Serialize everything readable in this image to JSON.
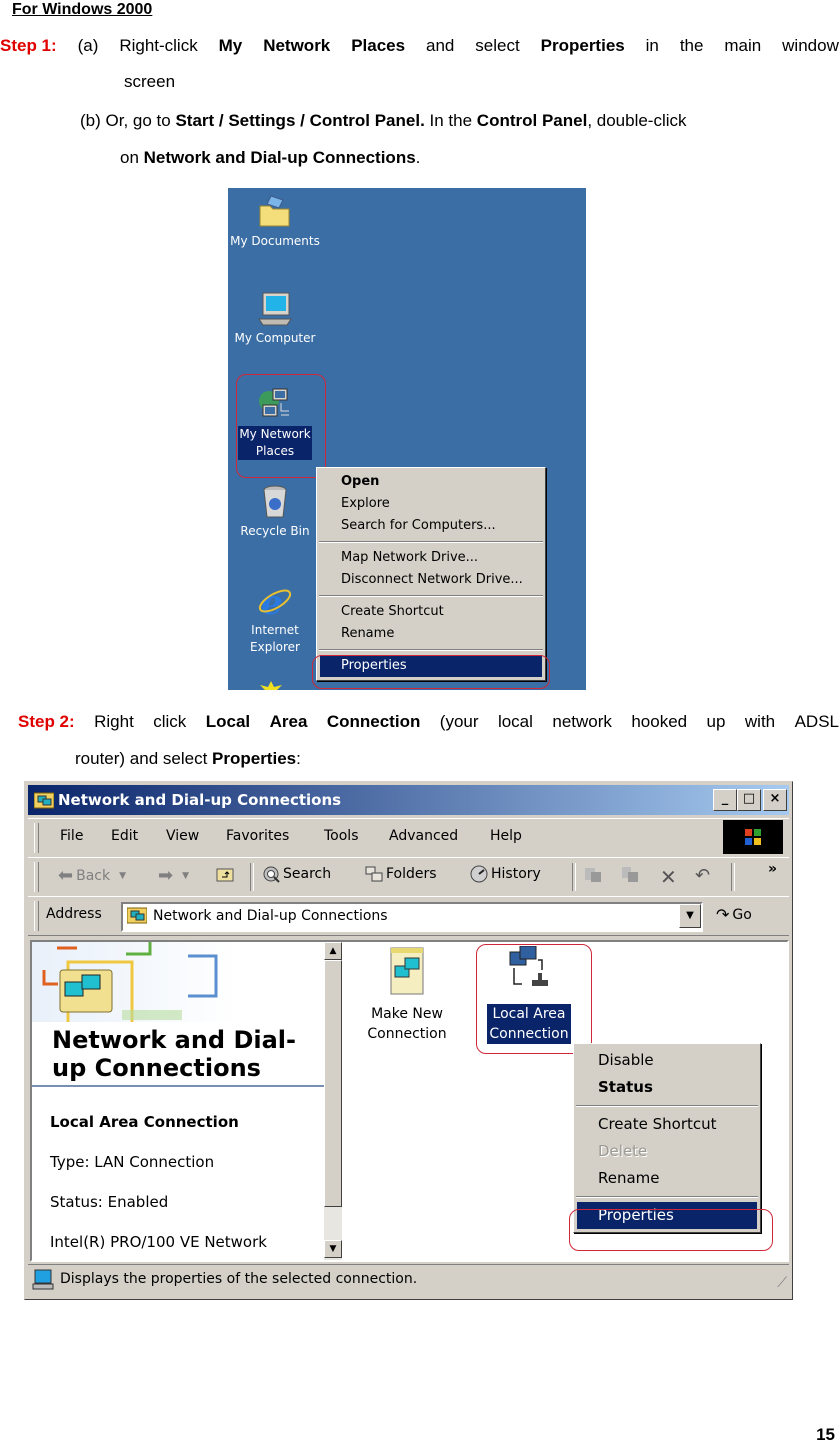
{
  "doc": {
    "heading": "For Windows 2000",
    "step1": {
      "label": "Step 1:",
      "a_prefix": "(a)",
      "a_words": [
        "Right-click",
        "My",
        "Network",
        "Places",
        "and",
        "select",
        "Properties",
        "in",
        "the",
        "main",
        "window"
      ],
      "a_cont": "screen",
      "b_text1": "(b) Or, go to ",
      "b_bold1": "Start / Settings / Control Panel.",
      "b_text2": " In the ",
      "b_bold2": "Control Panel",
      "b_text3": ", double-click",
      "b_cont_text": "on ",
      "b_cont_bold": "Network and Dial-up Connections",
      "b_cont_end": "."
    },
    "step2": {
      "label": "Step 2:",
      "words": [
        "Right",
        "click",
        "Local",
        "Area",
        "Connection",
        "(your",
        "local",
        "network",
        "hooked",
        "up",
        "with",
        "ADSL"
      ],
      "cont_text": "router) and select ",
      "cont_bold": "Properties",
      "cont_end": ":"
    },
    "page_number": "15"
  },
  "desktop": {
    "icons": [
      {
        "label": "My Documents",
        "icon": "my-documents-icon"
      },
      {
        "label": "My Computer",
        "icon": "my-computer-icon"
      },
      {
        "label": "My Network Places",
        "line1": "My Network",
        "line2": "Places",
        "icon": "my-network-places-icon",
        "selected": true
      },
      {
        "label": "Recycle Bin",
        "icon": "recycle-bin-icon"
      },
      {
        "label": "Internet Explorer",
        "line1": "Internet",
        "line2": "Explorer",
        "icon": "internet-explorer-icon"
      }
    ],
    "context_menu": {
      "groups": [
        [
          {
            "label": "Open",
            "bold": true
          },
          {
            "label": "Explore"
          },
          {
            "label": "Search for Computers..."
          }
        ],
        [
          {
            "label": "Map Network Drive..."
          },
          {
            "label": "Disconnect Network Drive..."
          }
        ],
        [
          {
            "label": "Create Shortcut"
          },
          {
            "label": "Rename"
          }
        ],
        [
          {
            "label": "Properties",
            "selected": true
          }
        ]
      ]
    }
  },
  "explorer": {
    "title": "Network and Dial-up Connections",
    "window_buttons": {
      "minimize": "_",
      "maximize": "□",
      "close": "×"
    },
    "menu": [
      "File",
      "Edit",
      "View",
      "Favorites",
      "Tools",
      "Advanced",
      "Help"
    ],
    "toolbar": {
      "back": "Back",
      "search": "Search",
      "folders": "Folders",
      "history": "History",
      "more": "»"
    },
    "address": {
      "label": "Address",
      "value": "Network and Dial-up Connections",
      "go": "Go"
    },
    "left_pane": {
      "title_line1": "Network and Dial-",
      "title_line2": "up Connections",
      "selected_name": "Local Area Connection",
      "type": "Type: LAN Connection",
      "status": "Status: Enabled",
      "device": "Intel(R) PRO/100 VE Network"
    },
    "items": [
      {
        "line1": "Make New",
        "line2": "Connection",
        "icon": "make-new-connection-icon"
      },
      {
        "line1": "Local Area",
        "line2": "Connection",
        "icon": "local-area-connection-icon",
        "selected": true
      }
    ],
    "context_menu": {
      "groups": [
        [
          {
            "label": "Disable"
          },
          {
            "label": "Status",
            "bold": true
          }
        ],
        [
          {
            "label": "Create Shortcut"
          },
          {
            "label": "Delete",
            "disabled": true
          },
          {
            "label": "Rename"
          }
        ],
        [
          {
            "label": "Properties",
            "selected": true
          }
        ]
      ]
    },
    "statusbar": "Displays the properties of the selected connection."
  },
  "colors": {
    "step_label": "#e00000",
    "desktop_bg": "#3a6ea5",
    "selection": "#0a246a",
    "highlight_circle": "#d0283a",
    "window_face": "#d4d0c8"
  }
}
